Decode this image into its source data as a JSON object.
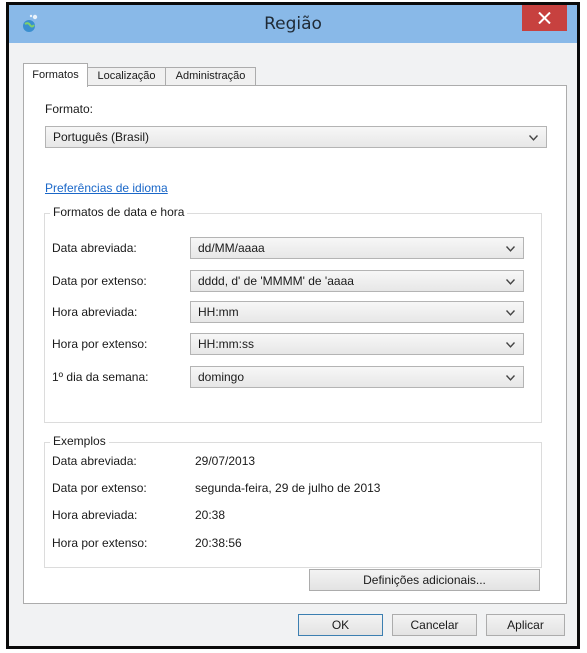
{
  "window": {
    "title": "Região"
  },
  "tabs": [
    {
      "label": "Formatos"
    },
    {
      "label": "Localização"
    },
    {
      "label": "Administração"
    }
  ],
  "format": {
    "label": "Formato:",
    "value": "Português (Brasil)"
  },
  "language_link": "Preferências de idioma",
  "datetime_group": {
    "title": "Formatos de data e hora",
    "rows": [
      {
        "label": "Data abreviada:",
        "value": "dd/MM/aaaa"
      },
      {
        "label": "Data por extenso:",
        "value": "dddd, d' de 'MMMM' de 'aaaa"
      },
      {
        "label": "Hora abreviada:",
        "value": "HH:mm"
      },
      {
        "label": "Hora por extenso:",
        "value": "HH:mm:ss"
      },
      {
        "label": "1º dia da semana:",
        "value": "domingo"
      }
    ]
  },
  "examples_group": {
    "title": "Exemplos",
    "rows": [
      {
        "label": "Data abreviada:",
        "value": "29/07/2013"
      },
      {
        "label": "Data por extenso:",
        "value": "segunda-feira, 29 de julho de 2013"
      },
      {
        "label": "Hora abreviada:",
        "value": "20:38"
      },
      {
        "label": "Hora por extenso:",
        "value": "20:38:56"
      }
    ]
  },
  "buttons": {
    "additional": "Definições adicionais...",
    "ok": "OK",
    "cancel": "Cancelar",
    "apply": "Aplicar"
  },
  "colors": {
    "titlebar": "#89b9e8",
    "close": "#c7413f",
    "link": "#1a67c8"
  },
  "icons": [
    "region-globe-icon",
    "close-icon",
    "chevron-down-icon"
  ]
}
